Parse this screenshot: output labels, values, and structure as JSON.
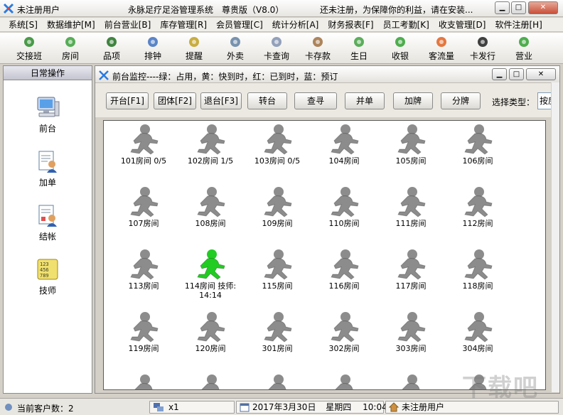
{
  "window": {
    "user_title": "未注册用户",
    "app_title": "永脉足疗足浴管理系统　尊贵版（V8.0）",
    "notice": "还未注册，为保障你的利益，请在安装..."
  },
  "menu": [
    "系统[S]",
    "数据维护[M]",
    "前台营业[B]",
    "库存管理[R]",
    "会员管理[C]",
    "统计分析[A]",
    "财务报表[F]",
    "员工考勤[K]",
    "收支管理[D]",
    "软件注册[H]"
  ],
  "toolbar": [
    {
      "label": "交接班",
      "icon": "money-bag-icon"
    },
    {
      "label": "房间",
      "icon": "room-icon"
    },
    {
      "label": "品项",
      "icon": "items-icon"
    },
    {
      "label": "排钟",
      "icon": "schedule-icon"
    },
    {
      "label": "提醒",
      "icon": "alarm-icon"
    },
    {
      "label": "外卖",
      "icon": "takeout-icon"
    },
    {
      "label": "卡查询",
      "icon": "card-query-icon"
    },
    {
      "label": "卡存款",
      "icon": "card-deposit-icon"
    },
    {
      "label": "生日",
      "icon": "birthday-icon"
    },
    {
      "label": "收银",
      "icon": "cashier-icon"
    },
    {
      "label": "客流量",
      "icon": "chart-icon"
    },
    {
      "label": "卡发行",
      "icon": "card-issue-icon"
    },
    {
      "label": "营业",
      "icon": "palm-tree-icon"
    }
  ],
  "left_panel": {
    "title": "日常操作",
    "items": [
      {
        "label": "前台",
        "icon": "computer-icon"
      },
      {
        "label": "加单",
        "icon": "add-order-icon"
      },
      {
        "label": "结帐",
        "icon": "checkout-icon"
      },
      {
        "label": "技师",
        "icon": "technician-icon"
      }
    ]
  },
  "monitor": {
    "title": "前台监控----绿：占用，黄：快到时，红：已到时，蓝：预订",
    "buttons": [
      "开台[F1]",
      "团体[F2]",
      "退台[F3]",
      "转台",
      "查寻",
      "并单",
      "加牌",
      "分牌"
    ],
    "type_label": "选择类型：",
    "type_value": "按房",
    "rooms": [
      {
        "label": "101房间 0/5",
        "status": "free"
      },
      {
        "label": "102房间 1/5",
        "status": "free"
      },
      {
        "label": "103房间 0/5",
        "status": "free"
      },
      {
        "label": "104房间",
        "status": "free"
      },
      {
        "label": "105房间",
        "status": "free"
      },
      {
        "label": "106房间",
        "status": "free"
      },
      {
        "label": "107房间",
        "status": "free"
      },
      {
        "label": "108房间",
        "status": "free"
      },
      {
        "label": "109房间",
        "status": "free"
      },
      {
        "label": "110房间",
        "status": "free"
      },
      {
        "label": "111房间",
        "status": "free"
      },
      {
        "label": "112房间",
        "status": "free"
      },
      {
        "label": "113房间",
        "status": "free"
      },
      {
        "label": "114房间 技师:\n14:14",
        "status": "occupied"
      },
      {
        "label": "115房间",
        "status": "free"
      },
      {
        "label": "116房间",
        "status": "free"
      },
      {
        "label": "117房间",
        "status": "free"
      },
      {
        "label": "118房间",
        "status": "free"
      },
      {
        "label": "119房间",
        "status": "free"
      },
      {
        "label": "120房间",
        "status": "free"
      },
      {
        "label": "301房间",
        "status": "free"
      },
      {
        "label": "302房间",
        "status": "free"
      },
      {
        "label": "303房间",
        "status": "free"
      },
      {
        "label": "304房间",
        "status": "free"
      },
      {
        "label": "",
        "status": "free"
      },
      {
        "label": "",
        "status": "free"
      },
      {
        "label": "",
        "status": "free"
      },
      {
        "label": "",
        "status": "free"
      },
      {
        "label": "",
        "status": "free"
      },
      {
        "label": "",
        "status": "free"
      }
    ]
  },
  "status_colors": {
    "free": "#8c8c8c",
    "occupied": "#22cc22",
    "soon": "#e8d020",
    "due": "#e02020",
    "reserved": "#2050e0"
  },
  "statusbar": {
    "customers": "当前客户数：2",
    "zoom": "x1",
    "date": "2017年3月30日",
    "weekday": "星期四",
    "time": "10:04",
    "user": "未注册用户"
  },
  "watermark": "下载吧"
}
